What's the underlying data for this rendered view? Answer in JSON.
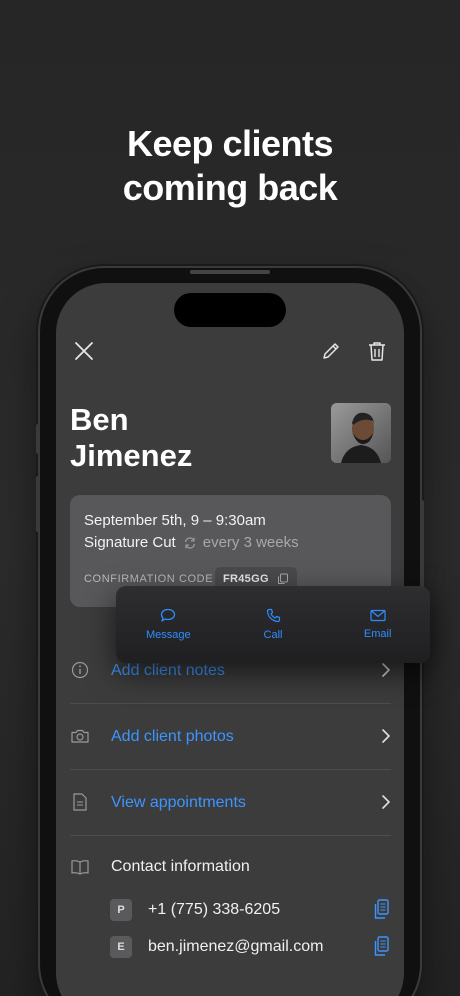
{
  "headline": {
    "line1": "Keep clients",
    "line2": "coming back"
  },
  "toolbar": {
    "close_icon": "close-icon",
    "edit_icon": "pencil-icon",
    "delete_icon": "trash-icon"
  },
  "client": {
    "first_name": "Ben",
    "last_name": "Jimenez",
    "avatar_icon": "client-photo"
  },
  "appointment": {
    "date_time": "September 5th, 9 – 9:30am",
    "service": "Signature Cut",
    "repeat": "every 3 weeks",
    "confirmation_label": "CONFIRMATION CODE",
    "confirmation_code": "FR45GG"
  },
  "contact_popup": {
    "actions": [
      {
        "label": "Message",
        "icon": "chat-bubble-icon"
      },
      {
        "label": "Call",
        "icon": "phone-icon"
      },
      {
        "label": "Email",
        "icon": "envelope-icon"
      }
    ]
  },
  "rows": [
    {
      "label": "Add client notes",
      "icon": "info-icon"
    },
    {
      "label": "Add client photos",
      "icon": "camera-icon"
    },
    {
      "label": "View appointments",
      "icon": "document-icon"
    }
  ],
  "contact_info": {
    "title": "Contact information",
    "phone_badge": "P",
    "phone": "+1 (775) 338-6205",
    "email_badge": "E",
    "email": "ben.jimenez@gmail.com"
  },
  "colors": {
    "accent": "#3d95ff",
    "screen_bg": "#3c3c3d",
    "card_bg": "#58585a",
    "page_bg": "#262626"
  }
}
